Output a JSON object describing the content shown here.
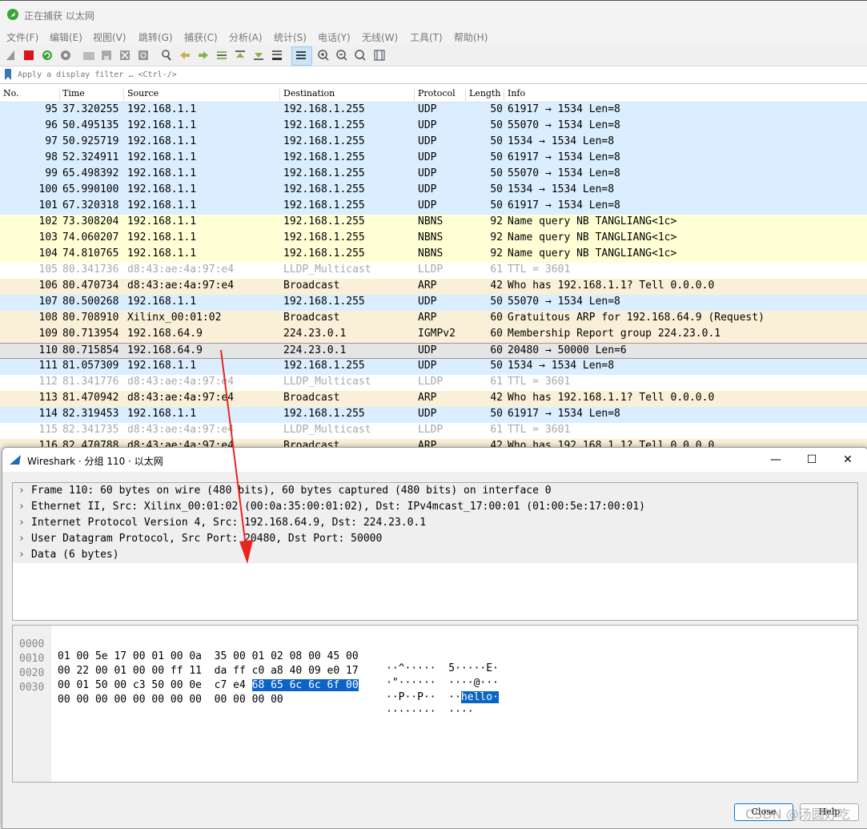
{
  "window": {
    "title": "正在捕获 以太网"
  },
  "menu": [
    "文件(F)",
    "编辑(E)",
    "视图(V)",
    "跳转(G)",
    "捕获(C)",
    "分析(A)",
    "统计(S)",
    "电话(Y)",
    "无线(W)",
    "工具(T)",
    "帮助(H)"
  ],
  "toolbar": {
    "icons": [
      "shark-fin-start-icon",
      "stop-capture-icon",
      "restart-capture-icon",
      "capture-options-icon",
      "open-file-icon",
      "save-file-icon",
      "close-file-icon",
      "reload-file-icon",
      "find-packet-icon",
      "go-back-icon",
      "go-forward-icon",
      "go-to-packet-icon",
      "go-first-icon",
      "go-last-icon",
      "auto-scroll-icon",
      "colorize-icon",
      "zoom-in-icon",
      "zoom-out-icon",
      "zoom-normal-icon",
      "resize-columns-icon"
    ]
  },
  "filter": {
    "placeholder": "Apply a display filter … <Ctrl-/>"
  },
  "columns": {
    "no": "No.",
    "time": "Time",
    "source": "Source",
    "destination": "Destination",
    "protocol": "Protocol",
    "length": "Length",
    "info": "Info"
  },
  "colors": {
    "udp": "#daeeff",
    "nbns": "#ffffd6",
    "arp": "#faf0d7",
    "lldp": "#ffffff",
    "igmp": "#faf0d7",
    "selected": "#e5e5e5",
    "highlight": "#0a64c8",
    "arrow": "#e8261e"
  },
  "packets": [
    {
      "no": "95",
      "time": "37.320255",
      "src": "192.168.1.1",
      "dst": "192.168.1.255",
      "proto": "UDP",
      "len": "50",
      "info": "61917 → 1534 Len=8",
      "kind": "udp"
    },
    {
      "no": "96",
      "time": "50.495135",
      "src": "192.168.1.1",
      "dst": "192.168.1.255",
      "proto": "UDP",
      "len": "50",
      "info": "55070 → 1534 Len=8",
      "kind": "udp"
    },
    {
      "no": "97",
      "time": "50.925719",
      "src": "192.168.1.1",
      "dst": "192.168.1.255",
      "proto": "UDP",
      "len": "50",
      "info": "1534 → 1534 Len=8",
      "kind": "udp"
    },
    {
      "no": "98",
      "time": "52.324911",
      "src": "192.168.1.1",
      "dst": "192.168.1.255",
      "proto": "UDP",
      "len": "50",
      "info": "61917 → 1534 Len=8",
      "kind": "udp"
    },
    {
      "no": "99",
      "time": "65.498392",
      "src": "192.168.1.1",
      "dst": "192.168.1.255",
      "proto": "UDP",
      "len": "50",
      "info": "55070 → 1534 Len=8",
      "kind": "udp"
    },
    {
      "no": "100",
      "time": "65.990100",
      "src": "192.168.1.1",
      "dst": "192.168.1.255",
      "proto": "UDP",
      "len": "50",
      "info": "1534 → 1534 Len=8",
      "kind": "udp"
    },
    {
      "no": "101",
      "time": "67.320318",
      "src": "192.168.1.1",
      "dst": "192.168.1.255",
      "proto": "UDP",
      "len": "50",
      "info": "61917 → 1534 Len=8",
      "kind": "udp"
    },
    {
      "no": "102",
      "time": "73.308204",
      "src": "192.168.1.1",
      "dst": "192.168.1.255",
      "proto": "NBNS",
      "len": "92",
      "info": "Name query NB TANGLIANG<1c>",
      "kind": "nbns"
    },
    {
      "no": "103",
      "time": "74.060207",
      "src": "192.168.1.1",
      "dst": "192.168.1.255",
      "proto": "NBNS",
      "len": "92",
      "info": "Name query NB TANGLIANG<1c>",
      "kind": "nbns"
    },
    {
      "no": "104",
      "time": "74.810765",
      "src": "192.168.1.1",
      "dst": "192.168.1.255",
      "proto": "NBNS",
      "len": "92",
      "info": "Name query NB TANGLIANG<1c>",
      "kind": "nbns"
    },
    {
      "no": "105",
      "time": "80.341736",
      "src": "d8:43:ae:4a:97:e4",
      "dst": "LLDP_Multicast",
      "proto": "LLDP",
      "len": "61",
      "info": "TTL = 3601",
      "kind": "lldp"
    },
    {
      "no": "106",
      "time": "80.470734",
      "src": "d8:43:ae:4a:97:e4",
      "dst": "Broadcast",
      "proto": "ARP",
      "len": "42",
      "info": "Who has 192.168.1.1? Tell 0.0.0.0",
      "kind": "arp"
    },
    {
      "no": "107",
      "time": "80.500268",
      "src": "192.168.1.1",
      "dst": "192.168.1.255",
      "proto": "UDP",
      "len": "50",
      "info": "55070 → 1534 Len=8",
      "kind": "udp"
    },
    {
      "no": "108",
      "time": "80.708910",
      "src": "Xilinx_00:01:02",
      "dst": "Broadcast",
      "proto": "ARP",
      "len": "60",
      "info": "Gratuitous ARP for 192.168.64.9 (Request)",
      "kind": "arp"
    },
    {
      "no": "109",
      "time": "80.713954",
      "src": "192.168.64.9",
      "dst": "224.23.0.1",
      "proto": "IGMPv2",
      "len": "60",
      "info": "Membership Report group 224.23.0.1",
      "kind": "igmp"
    },
    {
      "no": "110",
      "time": "80.715854",
      "src": "192.168.64.9",
      "dst": "224.23.0.1",
      "proto": "UDP",
      "len": "60",
      "info": "20480 → 50000 Len=6",
      "kind": "selected"
    },
    {
      "no": "111",
      "time": "81.057309",
      "src": "192.168.1.1",
      "dst": "192.168.1.255",
      "proto": "UDP",
      "len": "50",
      "info": "1534 → 1534 Len=8",
      "kind": "udp"
    },
    {
      "no": "112",
      "time": "81.341776",
      "src": "d8:43:ae:4a:97:e4",
      "dst": "LLDP_Multicast",
      "proto": "LLDP",
      "len": "61",
      "info": "TTL = 3601",
      "kind": "lldp"
    },
    {
      "no": "113",
      "time": "81.470942",
      "src": "d8:43:ae:4a:97:e4",
      "dst": "Broadcast",
      "proto": "ARP",
      "len": "42",
      "info": "Who has 192.168.1.1? Tell 0.0.0.0",
      "kind": "arp"
    },
    {
      "no": "114",
      "time": "82.319453",
      "src": "192.168.1.1",
      "dst": "192.168.1.255",
      "proto": "UDP",
      "len": "50",
      "info": "61917 → 1534 Len=8",
      "kind": "udp"
    },
    {
      "no": "115",
      "time": "82.341735",
      "src": "d8:43:ae:4a:97:e4",
      "dst": "LLDP_Multicast",
      "proto": "LLDP",
      "len": "61",
      "info": "TTL = 3601",
      "kind": "lldp"
    },
    {
      "no": "116",
      "time": "82.470788",
      "src": "d8:43:ae:4a:97:e4",
      "dst": "Broadcast",
      "proto": "ARP",
      "len": "42",
      "info": "Who has 192.168.1.1? Tell 0.0.0.0",
      "kind": "arp"
    }
  ],
  "dialog": {
    "title": "Wireshark · 分组 110 · 以太网",
    "minimize": "—",
    "maximize": "☐",
    "close": "✕",
    "tree": [
      "Frame 110: 60 bytes on wire (480 bits), 60 bytes captured (480 bits) on interface 0",
      "Ethernet II, Src: Xilinx_00:01:02 (00:0a:35:00:01:02), Dst: IPv4mcast_17:00:01 (01:00:5e:17:00:01)",
      "Internet Protocol Version 4, Src: 192.168.64.9, Dst: 224.23.0.1",
      "User Datagram Protocol, Src Port: 20480, Dst Port: 50000",
      "Data (6 bytes)"
    ],
    "bytes": [
      {
        "offset": "0000",
        "hex": "01 00 5e 17 00 01 00 0a  35 00 01 02 08 00 45 00",
        "hex_hl": "",
        "ascii": "··^·····  5·····E·",
        "ascii_hl": ""
      },
      {
        "offset": "0010",
        "hex": "00 22 00 01 00 00 ff 11  da ff c0 a8 40 09 e0 17",
        "hex_hl": "",
        "ascii": "·\"······  ····@···",
        "ascii_hl": ""
      },
      {
        "offset": "0020",
        "hex": "00 01 50 00 c3 50 00 0e  c7 e4 ",
        "hex_hl": "68 65 6c 6c 6f 00",
        "ascii": "··P··P··  ··",
        "ascii_hl": "hello·"
      },
      {
        "offset": "0030",
        "hex": "00 00 00 00 00 00 00 00  00 00 00 00",
        "hex_hl": "",
        "ascii": "········  ····",
        "ascii_hl": ""
      }
    ],
    "close_label": "Close",
    "help_label": "Help",
    "watermark": "CSDN @汤圆好吃"
  }
}
